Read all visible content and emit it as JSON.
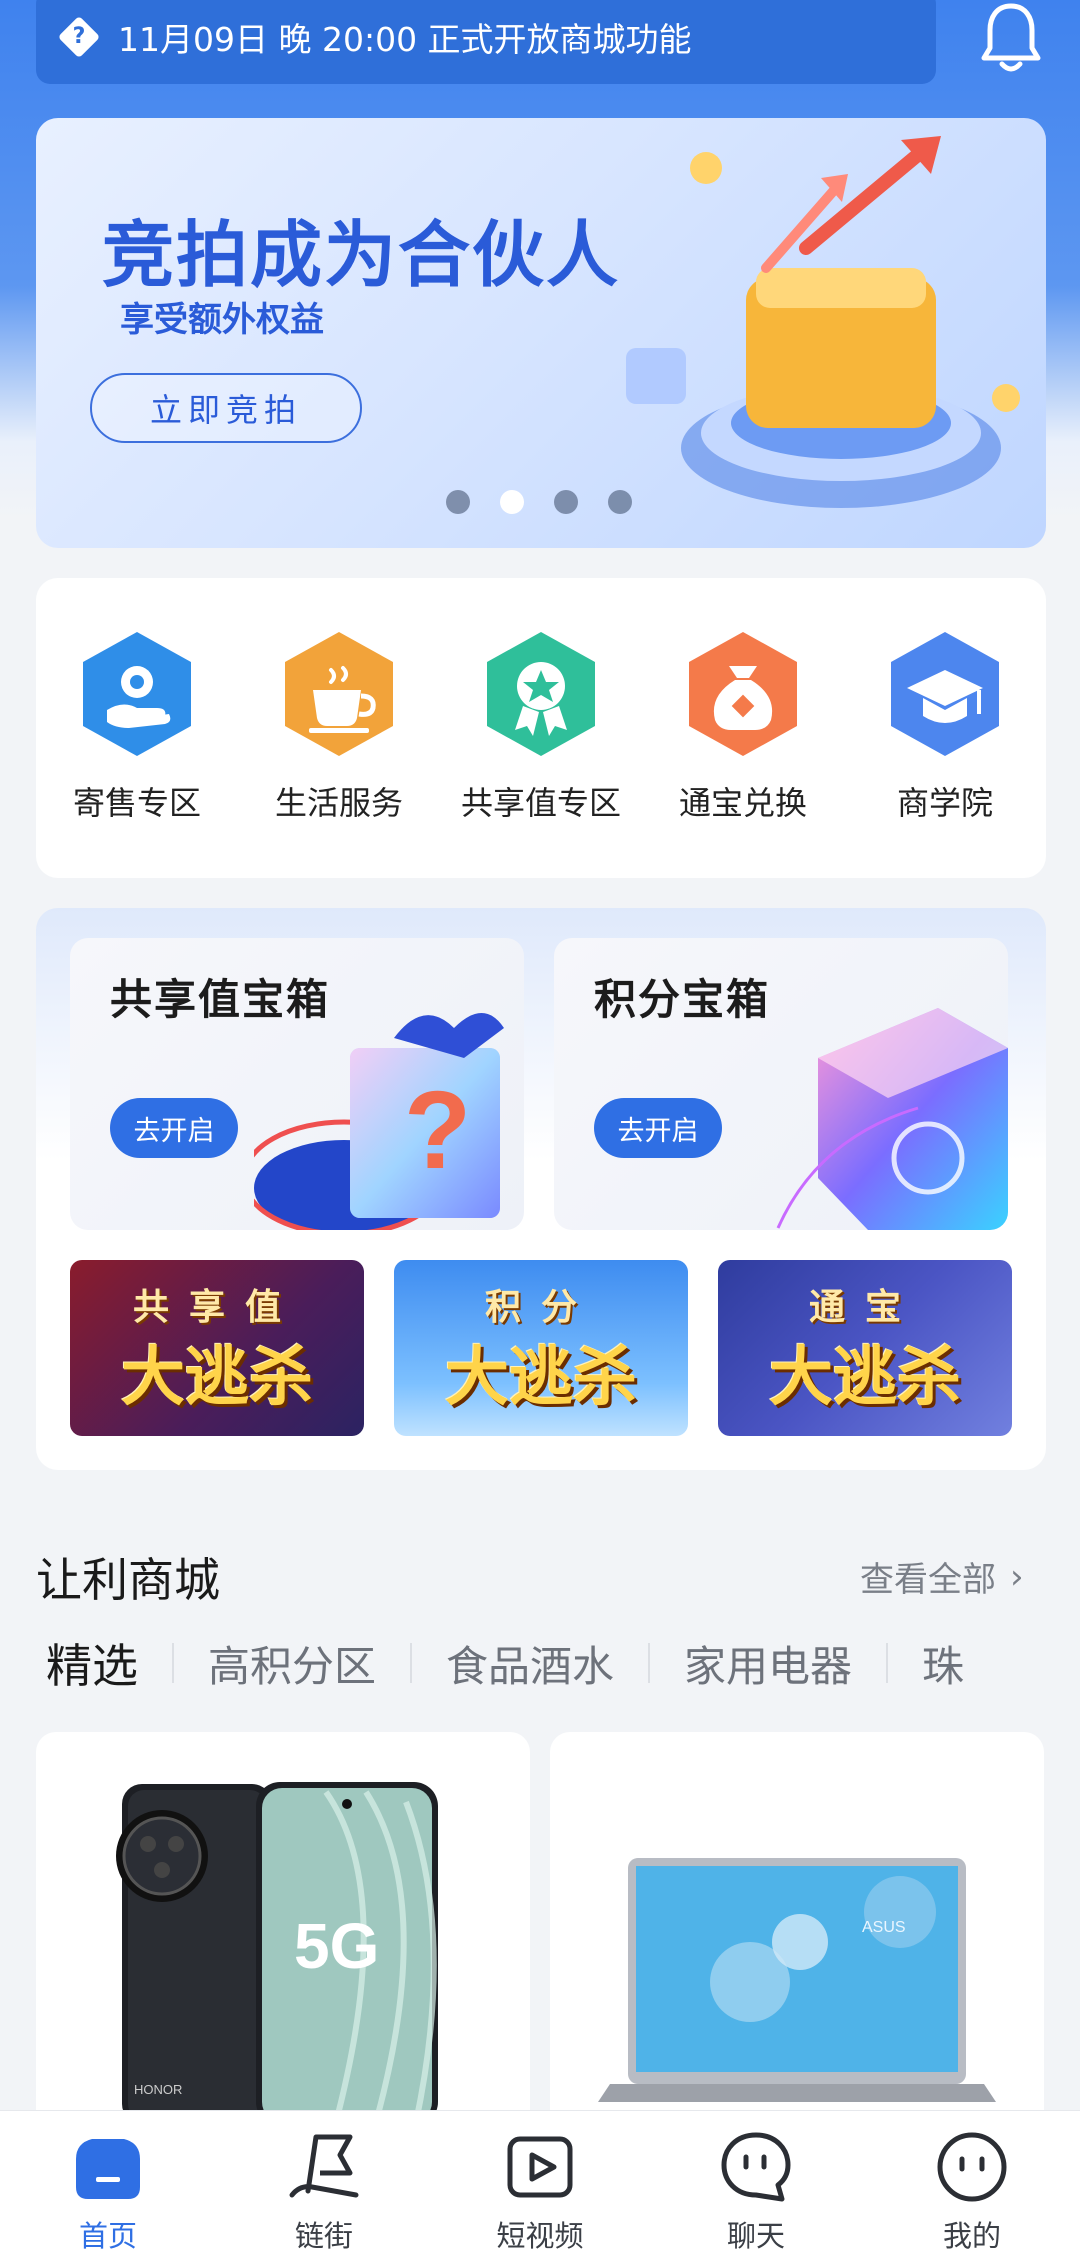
{
  "notice": {
    "text": "11月09日 晚 20:00 正式开放商城功能"
  },
  "banner": {
    "title": "竞拍成为合伙人",
    "subtitle": "享受额外权益",
    "button_label": "立即竞拍",
    "dots": {
      "count": 4,
      "active_index": 1
    }
  },
  "services": [
    {
      "label": "寄售专区",
      "icon": "hand-coin-icon",
      "color": "#2f8ee8"
    },
    {
      "label": "生活服务",
      "icon": "coffee-cup-icon",
      "color": "#f2a33a"
    },
    {
      "label": "共享值专区",
      "icon": "medal-star-icon",
      "color": "#2fbf9a"
    },
    {
      "label": "通宝兑换",
      "icon": "money-bag-icon",
      "color": "#f47a4a"
    },
    {
      "label": "商学院",
      "icon": "graduation-cap-icon",
      "color": "#4d86ee"
    }
  ],
  "treasure": {
    "cards": [
      {
        "title": "共享值宝箱",
        "button_label": "去开启"
      },
      {
        "title": "积分宝箱",
        "button_label": "去开启"
      }
    ],
    "sales": [
      {
        "top": "共享值",
        "main": "大逃杀"
      },
      {
        "top": "积分",
        "main": "大逃杀"
      },
      {
        "top": "通宝",
        "main": "大逃杀"
      }
    ]
  },
  "mall": {
    "title": "让利商城",
    "view_all": "查看全部",
    "tabs": [
      "精选",
      "高积分区",
      "食品酒水",
      "家用电器",
      "珠"
    ],
    "products": [
      {
        "name": "phone-5g-product",
        "image_text": "5G",
        "brand": "HONOR"
      },
      {
        "name": "laptop-product",
        "brand": "ASUS"
      }
    ]
  },
  "bottom_nav": {
    "items": [
      {
        "label": "首页",
        "icon": "home-icon",
        "active": true
      },
      {
        "label": "链街",
        "icon": "flag-icon",
        "active": false
      },
      {
        "label": "短视频",
        "icon": "video-play-icon",
        "active": false
      },
      {
        "label": "聊天",
        "icon": "chat-bubble-icon",
        "active": false
      },
      {
        "label": "我的",
        "icon": "profile-face-icon",
        "active": false
      }
    ]
  },
  "colors": {
    "primary": "#2f6fe4",
    "header_blue": "#3f82ee",
    "page_bg": "#f2f4f7"
  }
}
